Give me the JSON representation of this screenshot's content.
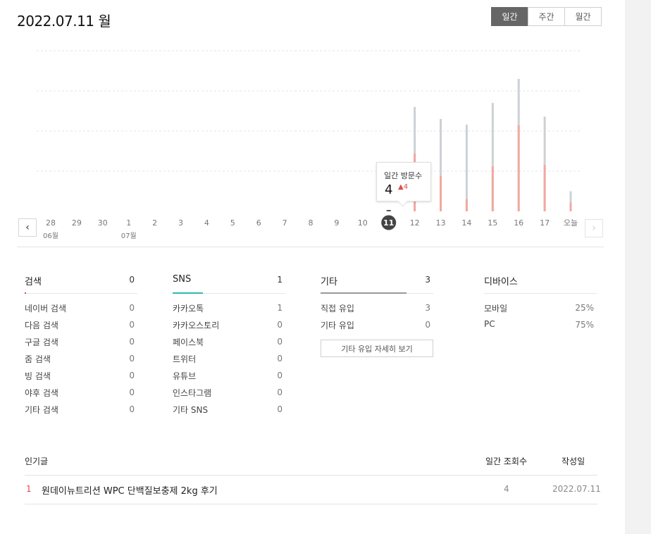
{
  "header": {
    "date_title": "2022.07.11 월"
  },
  "period_tabs": [
    {
      "label": "일간",
      "active": true
    },
    {
      "label": "주간",
      "active": false
    },
    {
      "label": "월간",
      "active": false
    }
  ],
  "chart_data": {
    "type": "bar",
    "categories": [
      "28",
      "29",
      "30",
      "1",
      "2",
      "3",
      "4",
      "5",
      "6",
      "7",
      "8",
      "9",
      "10",
      "11",
      "12",
      "13",
      "14",
      "15",
      "16",
      "17",
      "오늘"
    ],
    "month_labels": [
      {
        "at": "28",
        "label": "06월"
      },
      {
        "at": "1",
        "label": "07월"
      }
    ],
    "selected": "11",
    "series": [
      {
        "values": [
          0,
          0,
          0,
          0,
          0,
          0,
          0,
          0,
          0,
          0,
          0,
          0,
          0,
          4,
          13,
          11.5,
          10.8,
          13.5,
          16.5,
          11.8,
          2.5
        ],
        "color": "#cdd1d5"
      },
      {
        "values": [
          0,
          0,
          0,
          0,
          0,
          0,
          0,
          0,
          0,
          0,
          0,
          0,
          0,
          4,
          7.2,
          4.4,
          1.5,
          5.6,
          10.7,
          5.8,
          1.1
        ],
        "color": "#f2a8a0"
      }
    ],
    "ylim": [
      0,
      20
    ],
    "grid": true
  },
  "tooltip": {
    "label": "일간 방문수",
    "value": "4",
    "delta": "▲4"
  },
  "nav": {
    "prev": "‹",
    "next": "›"
  },
  "stats": {
    "search": {
      "title": "검색",
      "total": "0",
      "rows": [
        {
          "k": "네이버 검색",
          "v": "0"
        },
        {
          "k": "다음 검색",
          "v": "0"
        },
        {
          "k": "구글 검색",
          "v": "0"
        },
        {
          "k": "줌 검색",
          "v": "0"
        },
        {
          "k": "빙 검색",
          "v": "0"
        },
        {
          "k": "야후 검색",
          "v": "0"
        },
        {
          "k": "기타 검색",
          "v": "0"
        }
      ],
      "share": 0.01,
      "color": "#e04a4a"
    },
    "sns": {
      "title": "SNS",
      "total": "1",
      "rows": [
        {
          "k": "카카오톡",
          "v": "1"
        },
        {
          "k": "카카오스토리",
          "v": "0"
        },
        {
          "k": "페이스북",
          "v": "0"
        },
        {
          "k": "트위터",
          "v": "0"
        },
        {
          "k": "유튜브",
          "v": "0"
        },
        {
          "k": "인스타그램",
          "v": "0"
        },
        {
          "k": "기타 SNS",
          "v": "0"
        }
      ],
      "share": 0.27,
      "color": "#2bbbad"
    },
    "etc": {
      "title": "기타",
      "total": "3",
      "rows": [
        {
          "k": "직접 유입",
          "v": "3"
        },
        {
          "k": "기타 유입",
          "v": "0"
        }
      ],
      "share": 0.76,
      "color": "#999999",
      "more_label": "기타 유입 자세히 보기"
    },
    "device": {
      "title": "디바이스",
      "rows": [
        {
          "k": "모바일",
          "v": "25%"
        },
        {
          "k": "PC",
          "v": "75%"
        }
      ]
    }
  },
  "popular": {
    "header": {
      "title": "인기글",
      "views": "일간 조회수",
      "date": "작성일"
    },
    "rows": [
      {
        "rank": "1",
        "title": "원데이뉴트리션 WPC 단백질보충제 2kg 후기",
        "views": "4",
        "date": "2022.07.11"
      }
    ]
  }
}
